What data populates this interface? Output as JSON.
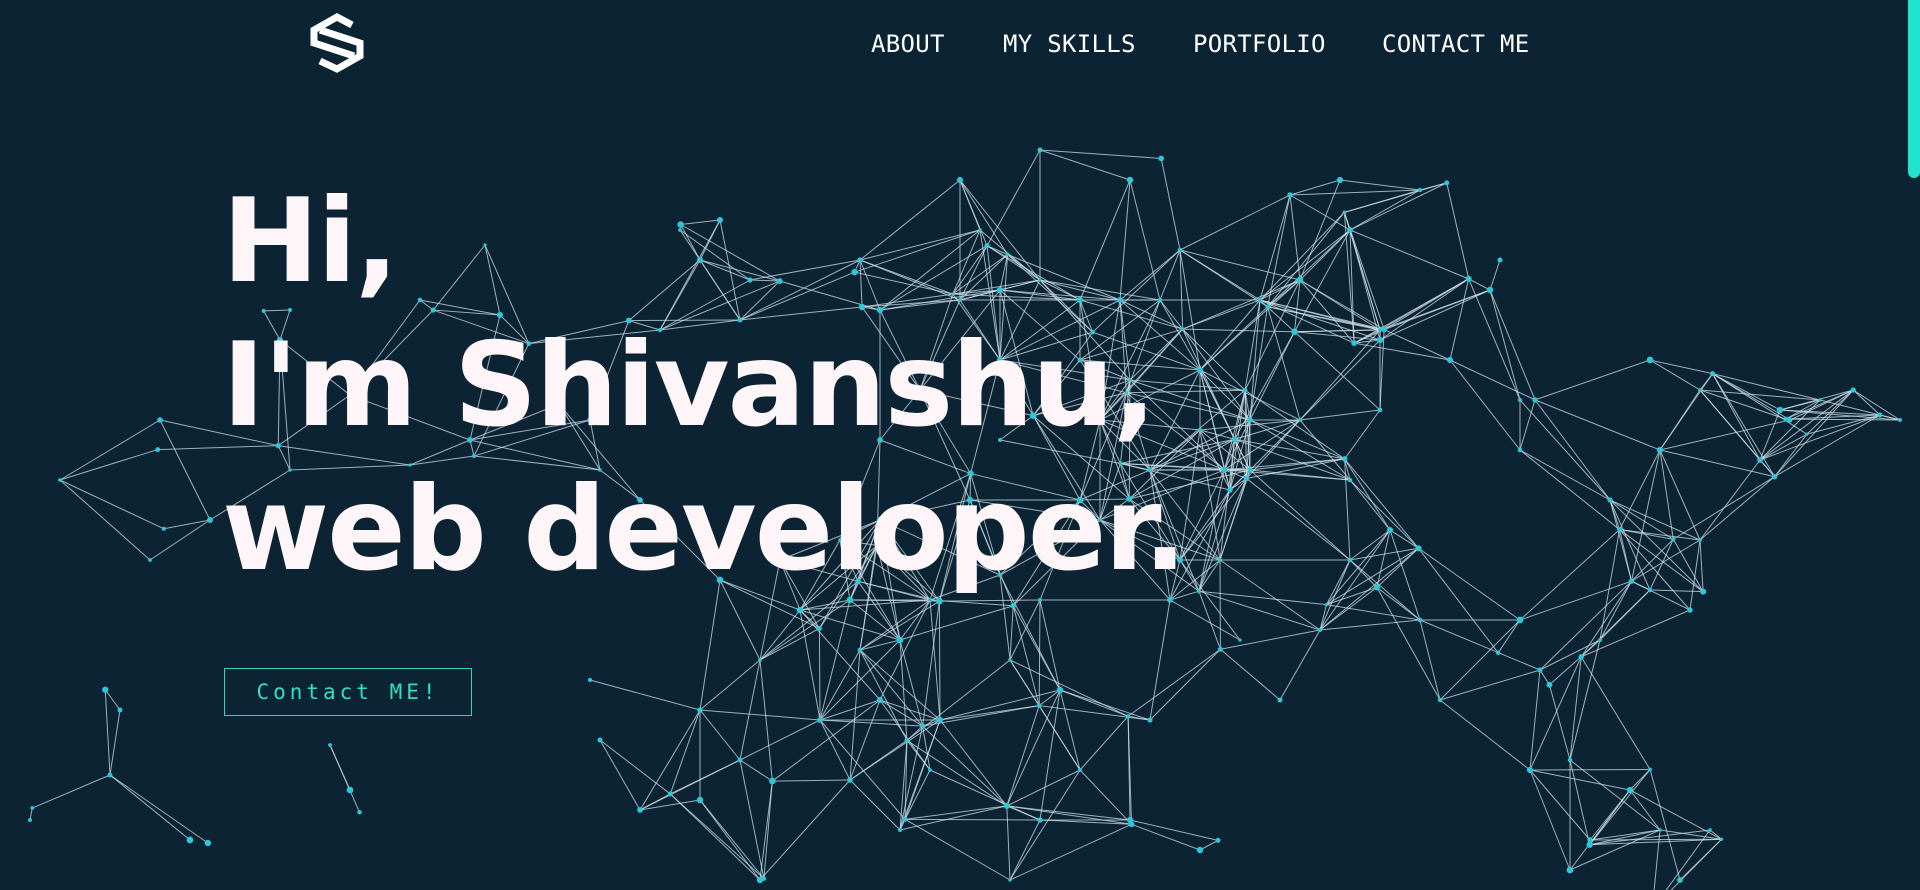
{
  "logo": {
    "icon": "s-hexagon-logo-icon",
    "color": "#ffffff"
  },
  "nav": {
    "items": [
      {
        "label": "ABOUT"
      },
      {
        "label": "MY SKILLS"
      },
      {
        "label": "PORTFOLIO"
      },
      {
        "label": "CONTACT ME"
      }
    ]
  },
  "hero": {
    "line1": "Hi,",
    "line2": "I'm Shivanshu,",
    "line3": "web developer."
  },
  "cta": {
    "label": "Contact ME!"
  },
  "background": {
    "icon": "particle-network-background",
    "color": "#0b2333",
    "line_color": "#cfe3ea",
    "dot_color": "#2fc6d8"
  },
  "scrollbar": {
    "color": "#20e3c9"
  }
}
